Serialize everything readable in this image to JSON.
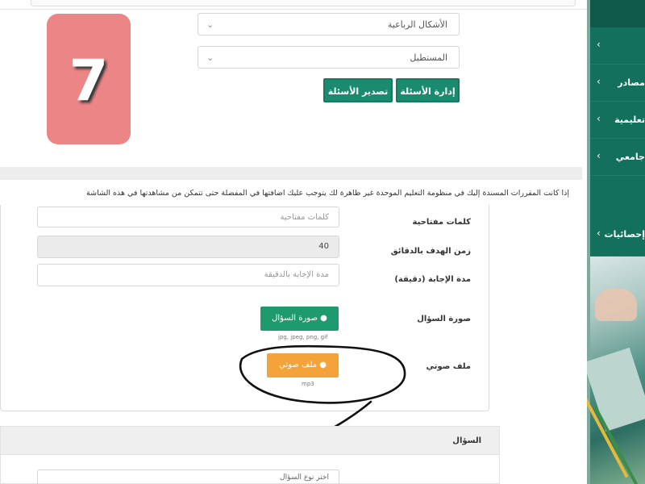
{
  "badge": {
    "number": "7"
  },
  "filters": {
    "shape_select": "الأشكال الرباعية",
    "subshape_select": "المستطيل"
  },
  "toolbar": {
    "manage_label": "إدارة الأسئلة",
    "export_label": "تصدير الأسئلة"
  },
  "notice": "إذا كانت المقررات المسندة إليك في منظومة التعليم الموحدة غير ظاهرة لك يتوجب عليك اضافتها في المفضلة حتى تتمكن من مشاهدتها في هذه الشاشة",
  "form": {
    "keywords_label": "كلمات مفتاحية",
    "keywords_placeholder": "كلمات مفتاحية",
    "target_time_label": "زمن الهدف بالدقائق",
    "target_time_value": "40",
    "answer_duration_label": "مدة الإجابة (دقيقة)",
    "answer_duration_placeholder": "مدة الإجابة بالدقيقة",
    "question_image_label": "صورة السؤال",
    "question_image_button": "صورة السؤال",
    "question_image_hint": "jpg, jpeg, png, gif",
    "audio_label": "ملف صوتي",
    "audio_button": "ملف صوتي",
    "audio_hint": "mp3"
  },
  "lower": {
    "title": "السؤال",
    "select_value": "اختر نوع السؤال"
  },
  "sidebar": {
    "items": [
      {
        "label": ""
      },
      {
        "label": "مصادر"
      },
      {
        "label": "تعليمية"
      },
      {
        "label": "جامعي"
      },
      {
        "label": "إحصائيات"
      }
    ]
  },
  "colors": {
    "primary_green": "#1b8b6f",
    "orange": "#f3a33a",
    "badge": "#ec8585",
    "sidebar": "#0f5a4a"
  }
}
